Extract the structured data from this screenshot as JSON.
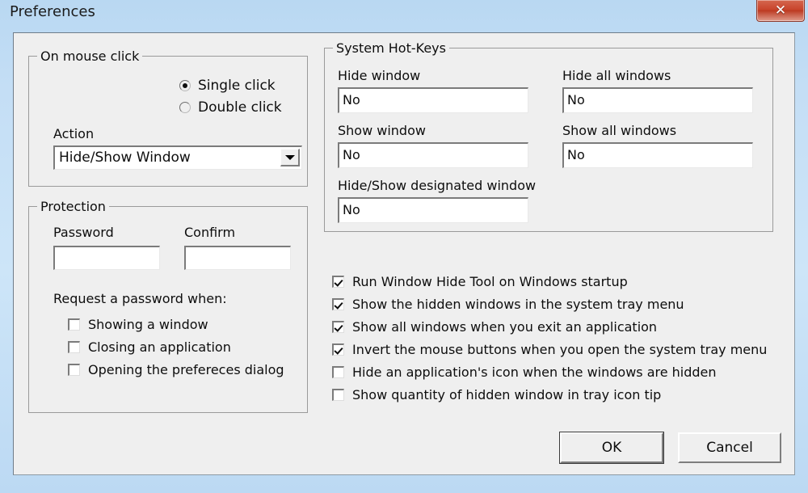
{
  "window": {
    "title": "Preferences",
    "close_button_glyph": "✕",
    "close_icon_name": "close-icon"
  },
  "mouse_click_group": {
    "title": "On mouse click",
    "radios": [
      {
        "label": "Single click",
        "checked": true
      },
      {
        "label": "Double click",
        "checked": false
      }
    ],
    "action_label": "Action",
    "action_value": "Hide/Show Window",
    "action_options": [
      "Hide/Show Window"
    ]
  },
  "protection_group": {
    "title": "Protection",
    "password_label": "Password",
    "password_value": "",
    "password_placeholder": "",
    "confirm_label": "Confirm",
    "confirm_value": "",
    "confirm_placeholder": "",
    "request_label": "Request a password when:",
    "checkboxes": [
      {
        "label": "Showing a window",
        "checked": false
      },
      {
        "label": "Closing an application",
        "checked": false
      },
      {
        "label": "Opening the prefereces dialog",
        "checked": false
      }
    ]
  },
  "hotkeys_group": {
    "title": "System Hot-Keys",
    "fields": [
      {
        "label": "Hide window",
        "value": "No"
      },
      {
        "label": "Hide all windows",
        "value": "No"
      },
      {
        "label": "Show window",
        "value": "No"
      },
      {
        "label": "Show all windows",
        "value": "No"
      },
      {
        "label": "Hide/Show designated window",
        "value": "No"
      }
    ]
  },
  "options": [
    {
      "label": "Run Window Hide Tool on Windows startup",
      "checked": true
    },
    {
      "label": "Show the hidden windows in the system tray menu",
      "checked": true
    },
    {
      "label": "Show all windows when you exit an application",
      "checked": true
    },
    {
      "label": "Invert the mouse buttons when you open the system tray menu",
      "checked": true
    },
    {
      "label": "Hide an application's icon when the windows are hidden",
      "checked": false
    },
    {
      "label": "Show quantity of hidden window in tray icon tip",
      "checked": false
    }
  ],
  "buttons": {
    "ok": "OK",
    "cancel": "Cancel"
  },
  "colors": {
    "dialog_bg": "#efefef",
    "frame_blue": "#c4def5",
    "close_red": "#c9452c",
    "text": "#0d0d0d"
  }
}
